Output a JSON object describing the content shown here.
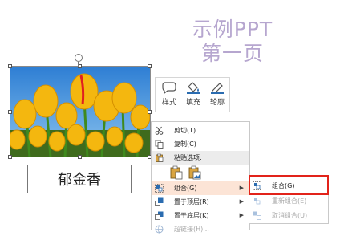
{
  "slide": {
    "title_line1": "示例PPT",
    "title_line2": "第一页",
    "textbox_text": "郁金香"
  },
  "mini_toolbar": {
    "style_label": "样式",
    "fill_label": "填充",
    "outline_label": "轮廓"
  },
  "context_menu": {
    "items": [
      {
        "label": "剪切(T)",
        "icon": "scissors-icon"
      },
      {
        "label": "复制(C)",
        "icon": "copy-icon"
      },
      {
        "label": "粘贴选项:",
        "icon": "paste-icon"
      },
      {
        "label": "组合(G)",
        "icon": "group-icon",
        "has_submenu": true
      },
      {
        "label": "置于顶层(R)",
        "icon": "bring-to-front-icon",
        "has_submenu": true
      },
      {
        "label": "置于底层(K)",
        "icon": "send-to-back-icon",
        "has_submenu": true
      },
      {
        "label": "超链接(H)...",
        "icon": "hyperlink-icon",
        "disabled": true
      }
    ]
  },
  "submenu": {
    "items": [
      {
        "label": "组合(G)",
        "icon": "group-icon",
        "highlighted": true
      },
      {
        "label": "重新组合(E)",
        "icon": "regroup-icon",
        "disabled": true
      },
      {
        "label": "取消组合(U)",
        "icon": "ungroup-icon",
        "disabled": true
      }
    ]
  },
  "colors": {
    "title": "#b6a6cf",
    "menu_highlight": "#fce4d6",
    "callout_border": "#e2231a",
    "accent_blue": "#2b6cb0"
  }
}
